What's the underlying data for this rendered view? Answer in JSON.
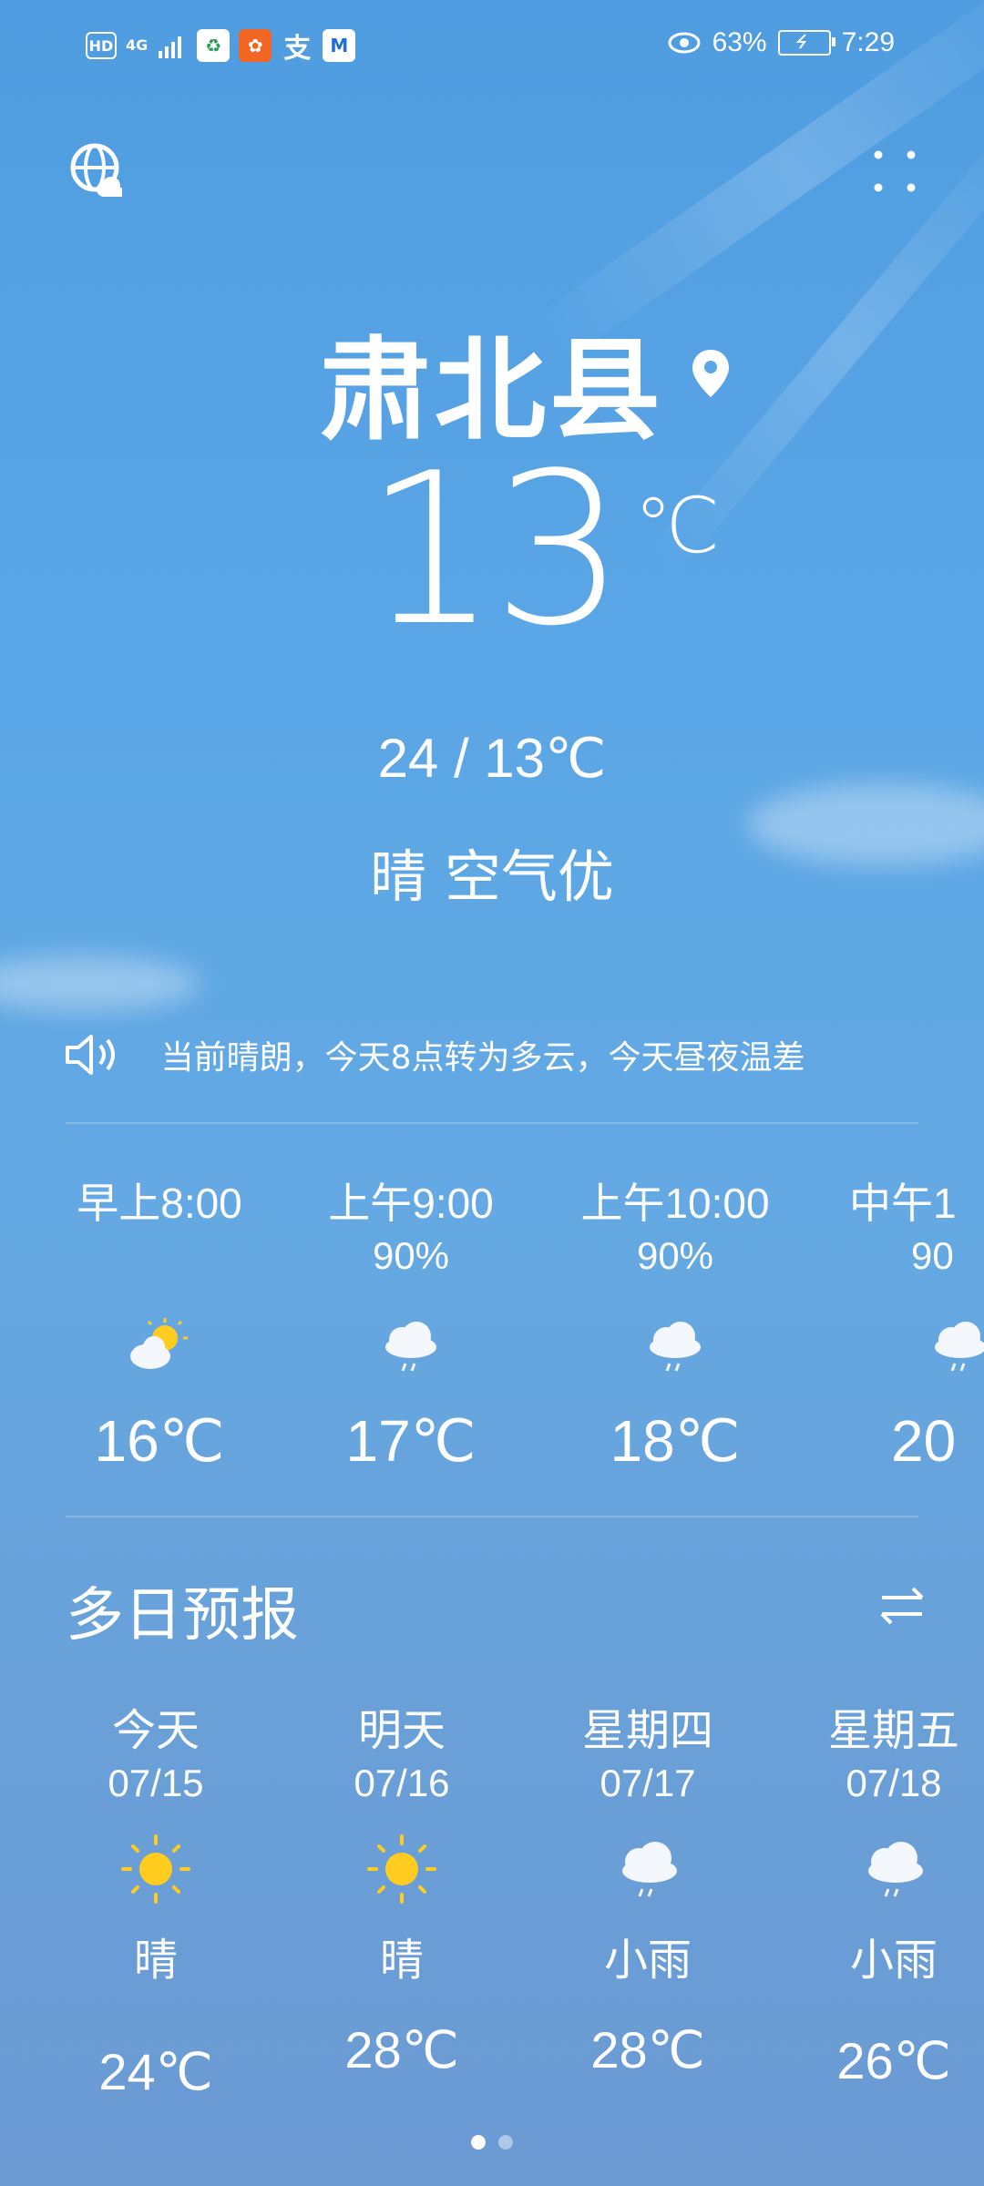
{
  "status_bar": {
    "network": "4G",
    "battery_percent": "63%",
    "time": "7:29"
  },
  "location": {
    "city": "肃北县"
  },
  "current": {
    "temperature": "13",
    "unit": "℃",
    "range": "24 / 13℃",
    "condition": "晴 空气优"
  },
  "broadcast": {
    "text": "当前晴朗，今天8点转为多云，今天昼夜温差"
  },
  "hourly": [
    {
      "time": "早上8:00",
      "precip": "",
      "icon": "partly-cloudy-icon",
      "temp": "16℃"
    },
    {
      "time": "上午9:00",
      "precip": "90%",
      "icon": "light-rain-icon",
      "temp": "17℃"
    },
    {
      "time": "上午10:00",
      "precip": "90%",
      "icon": "light-rain-icon",
      "temp": "18℃"
    },
    {
      "time": "中午1",
      "precip": "90",
      "icon": "light-rain-icon",
      "temp": "20"
    }
  ],
  "forecast": {
    "title": "多日预报",
    "days": [
      {
        "name": "今天",
        "date": "07/15",
        "icon": "sun-icon",
        "condition": "晴",
        "temp": "24℃"
      },
      {
        "name": "明天",
        "date": "07/16",
        "icon": "sun-icon",
        "condition": "晴",
        "temp": "28℃"
      },
      {
        "name": "星期四",
        "date": "07/17",
        "icon": "light-rain-icon",
        "condition": "小雨",
        "temp": "28℃"
      },
      {
        "name": "星期五",
        "date": "07/18",
        "icon": "light-rain-icon",
        "condition": "小雨",
        "temp": "26℃"
      }
    ]
  },
  "pagination": {
    "total": 2,
    "active": 1
  },
  "colors": {
    "sun": "#ffcc1f",
    "text": "#ffffff"
  }
}
